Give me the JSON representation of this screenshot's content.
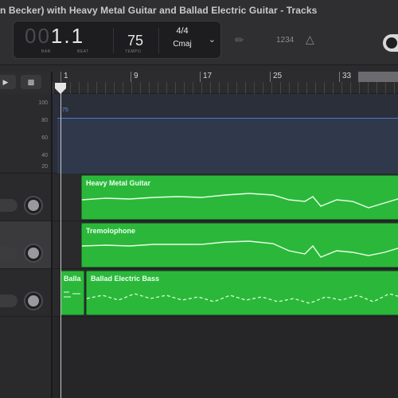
{
  "window": {
    "title": "n Becker) with Heavy Metal Guitar and Ballad Electric Guitar - Tracks"
  },
  "lcd": {
    "position_dim": "00",
    "position_bar": "1",
    "position_beat": "1",
    "bar_label": "BAR",
    "beat_label": "BEAT",
    "tempo": "75",
    "tempo_label": "TEMPO",
    "time_signature": "4/4",
    "key": "Cmaj"
  },
  "toolbar": {
    "tuner_icon": "tuning-fork-icon",
    "count_in_label": "1234",
    "metronome_icon": "metronome-icon"
  },
  "ruler": {
    "bars": [
      "1",
      "9",
      "17",
      "25",
      "33"
    ]
  },
  "automation": {
    "scale": [
      "100",
      "80",
      "60",
      "40",
      "20"
    ],
    "flag_label": "75"
  },
  "regions": [
    {
      "name": "Heavy Metal Guitar"
    },
    {
      "name": "Tremolophone"
    },
    {
      "name": "Balla"
    },
    {
      "name": "Ballad Electric Bass"
    }
  ],
  "colors": {
    "region_green": "#2bb83a",
    "automation_blue": "#4d79c9",
    "background": "#2b2b2d"
  }
}
